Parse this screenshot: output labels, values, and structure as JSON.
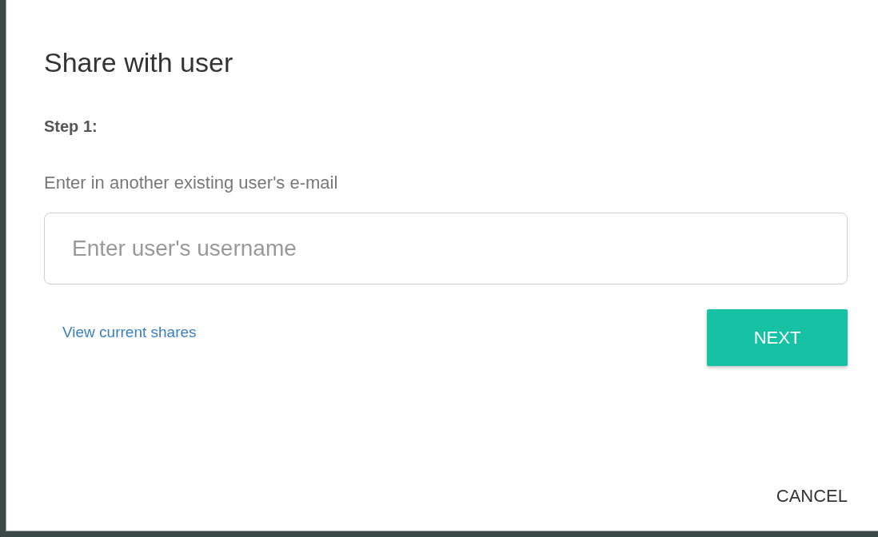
{
  "dialog": {
    "title": "Share with user",
    "step_label": "Step 1:",
    "instruction": "Enter in another existing user's e-mail",
    "username_field": {
      "placeholder": "Enter user's username"
    },
    "view_shares_link": "View current shares",
    "next_button": "NEXT",
    "cancel_button": "CANCEL"
  }
}
